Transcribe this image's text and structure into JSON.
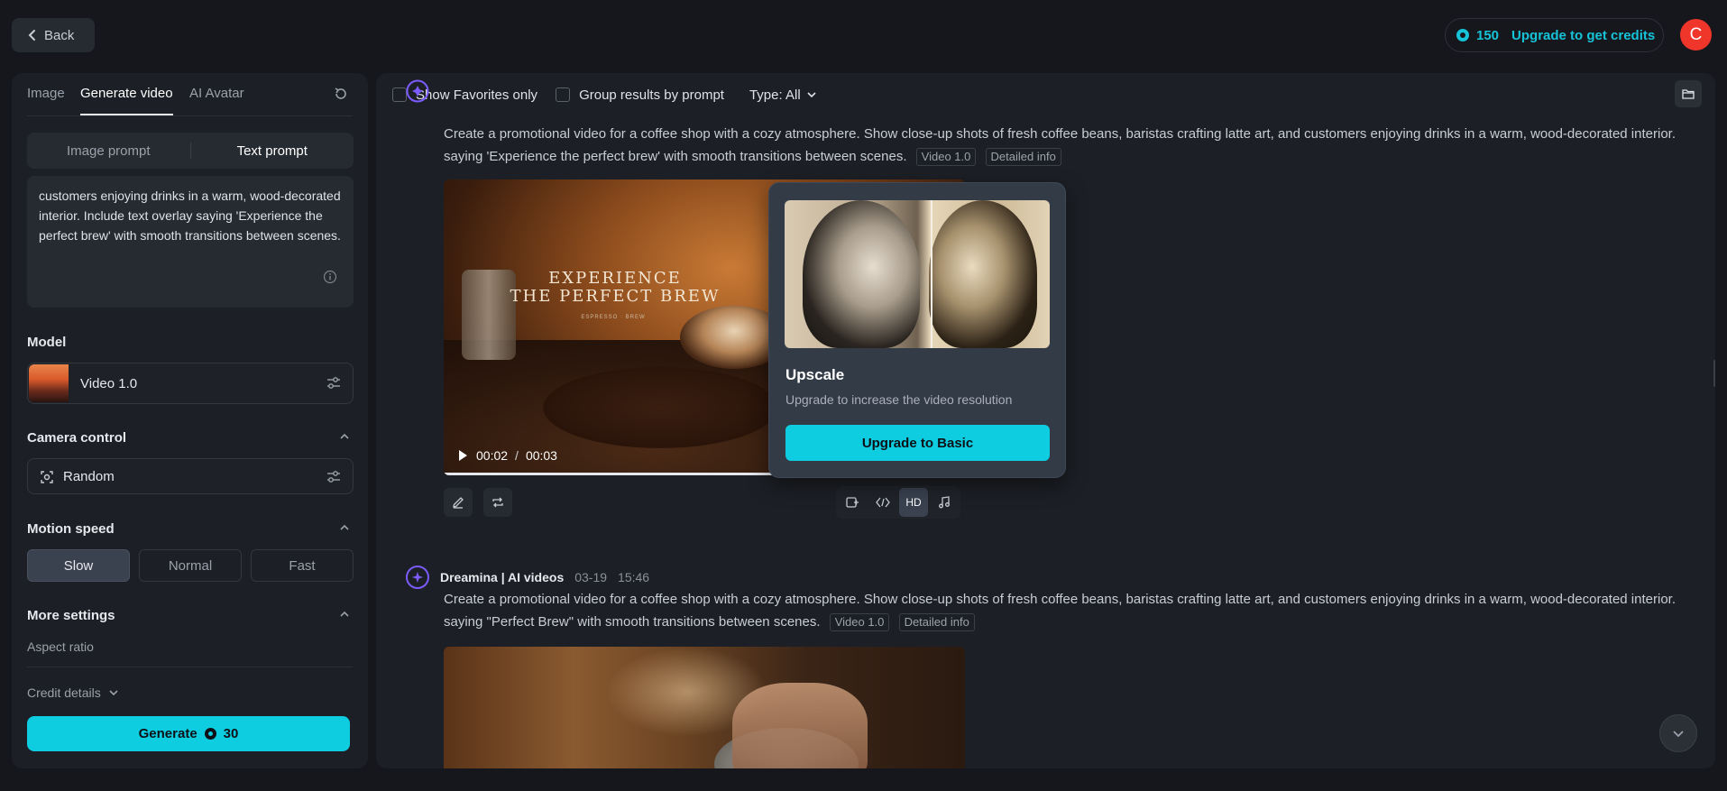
{
  "header": {
    "back_label": "Back",
    "credits_count": "150",
    "credits_upgrade": "Upgrade to get credits",
    "avatar_initial": "C"
  },
  "sidebar": {
    "tabs": [
      {
        "label": "Image"
      },
      {
        "label": "Generate video"
      },
      {
        "label": "AI Avatar"
      }
    ],
    "prompt_modes": [
      {
        "label": "Image prompt"
      },
      {
        "label": "Text prompt"
      }
    ],
    "prompt_text": "customers enjoying drinks in a warm, wood-decorated interior. Include text overlay saying 'Experience the perfect brew' with smooth transitions between scenes.",
    "model_label": "Model",
    "model_name": "Video 1.0",
    "camera_label": "Camera control",
    "camera_value": "Random",
    "motion_label": "Motion speed",
    "motion_options": [
      {
        "label": "Slow"
      },
      {
        "label": "Normal"
      },
      {
        "label": "Fast"
      }
    ],
    "more_settings_label": "More settings",
    "aspect_ratio_label": "Aspect ratio",
    "credit_details_label": "Credit details",
    "generate_label": "Generate",
    "generate_cost": "30"
  },
  "filters": {
    "favorites_label": "Show Favorites only",
    "group_label": "Group results by prompt",
    "type_label": "Type: All"
  },
  "results": [
    {
      "prompt": "Create a promotional video for a coffee shop with a cozy atmosphere. Show close-up shots of fresh coffee beans, baristas crafting latte art, and customers enjoying drinks in a warm, wood-decorated interior. saying 'Experience the perfect brew' with smooth transitions between scenes.",
      "model_tag": "Video 1.0",
      "info_tag": "Detailed info",
      "video_title_line1": "EXPERIENCE",
      "video_title_line2": "THE PERFECT BREW",
      "video_subtitle": "ESPRESSO · BREW",
      "current_time": "00:02",
      "duration": "00:03",
      "progress": 0.67
    },
    {
      "author": "Dreamina | AI videos",
      "date": "03-19",
      "time": "15:46",
      "prompt": "Create a promotional video for a coffee shop with a cozy atmosphere. Show close-up shots of fresh coffee beans, baristas crafting latte art, and customers enjoying drinks in a warm, wood-decorated interior. saying \"Perfect Brew\" with smooth transitions between scenes.",
      "model_tag": "Video 1.0",
      "info_tag": "Detailed info"
    }
  ],
  "tools": {
    "hd_label": "HD"
  },
  "upscale_popover": {
    "title": "Upscale",
    "description": "Upgrade to increase the video resolution",
    "button_label": "Upgrade to Basic"
  },
  "colors": {
    "accent": "#0ecde1",
    "avatar": "#f0352a",
    "brand_purple": "#7c5cff"
  }
}
